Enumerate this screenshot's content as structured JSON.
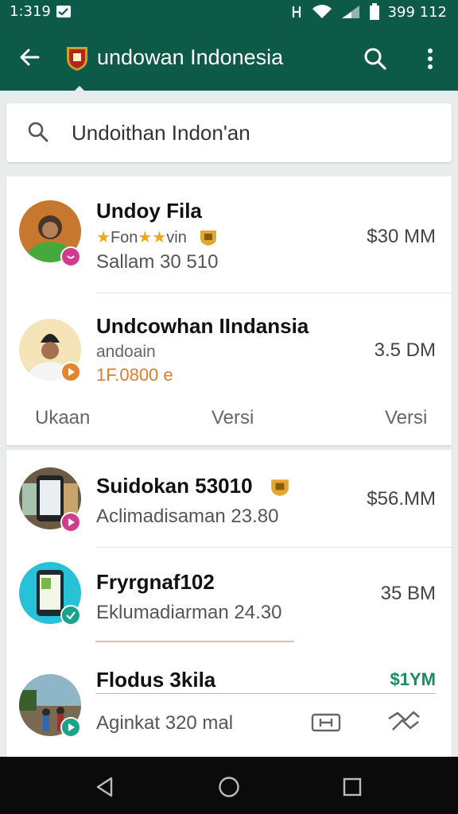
{
  "status_bar": {
    "time": "1:319",
    "battery_text": "399 112"
  },
  "app_bar": {
    "title": "undowan Indonesia"
  },
  "search": {
    "value": "Undoithan Indon'an"
  },
  "items": [
    {
      "name": "Undoy Fila",
      "rating_text": "Fon",
      "rating_suffix": "vin",
      "sub": "Sallam 30 510",
      "price": "$30 MM",
      "badge_color": "#d13c8c"
    },
    {
      "name": "Undcowhan IIndansia",
      "sub": "andoain",
      "sub2": "1F.0800 e",
      "price": "3.5 DM",
      "badge_color": "#e4862f"
    },
    {
      "name": "Suidokan 53010",
      "sub": "Aclimadisaman 23.80",
      "price": "$56.MM",
      "badge_color": "#d13c8c"
    },
    {
      "name": "Fryrgnaf102",
      "sub": "Eklumadiarman 24.30",
      "price": "35 BM",
      "badge_color": "#1aa28a"
    },
    {
      "name": "Flodus 3kila",
      "sub": "Aginkat 320 mal",
      "price": "$1YM",
      "price_color": "#1a8c5a",
      "badge_color": "#1aa28a"
    }
  ],
  "tabs": [
    "Ukaan",
    "Versi",
    "Versi"
  ]
}
